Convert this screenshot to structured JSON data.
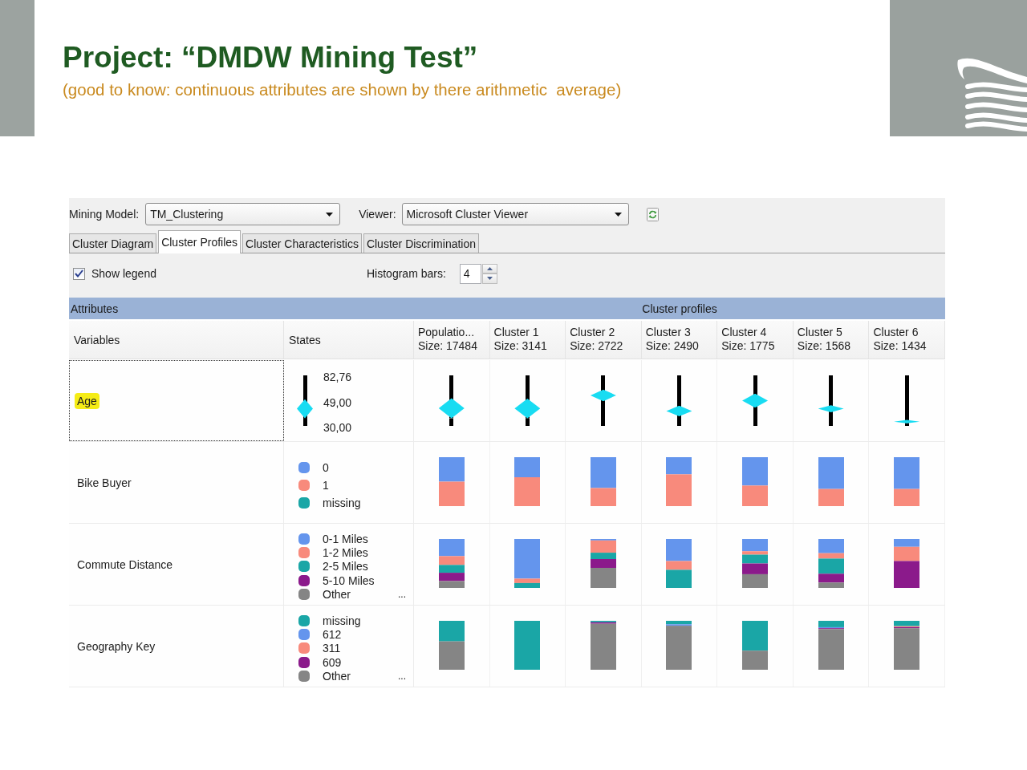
{
  "slide": {
    "title": "Project: “DMDW Mining Test”",
    "subtitle": "(good to know: continuous attributes are shown by there arithmetic  average)"
  },
  "toolbar": {
    "mining_model": {
      "label": "Mining Model:",
      "value": "TM_Clustering"
    },
    "viewer": {
      "label": "Viewer:",
      "value": "Microsoft Cluster Viewer"
    }
  },
  "tabs": [
    {
      "label": "Cluster Diagram",
      "selected": false
    },
    {
      "label": "Cluster Profiles",
      "selected": true
    },
    {
      "label": "Cluster Characteristics",
      "selected": false
    },
    {
      "label": "Cluster Discrimination",
      "selected": false
    }
  ],
  "options": {
    "show_legend": {
      "label": "Show legend",
      "checked": true
    },
    "histogram_bars": {
      "label": "Histogram bars:",
      "value": "4"
    }
  },
  "section_bar": {
    "attributes": "Attributes",
    "profiles": "Cluster profiles"
  },
  "grid": {
    "variables_heading": "Variables",
    "states_heading": "States",
    "clusters": [
      {
        "name": "Populatio...",
        "size": "Size: 17484"
      },
      {
        "name": "Cluster 1",
        "size": "Size: 3141"
      },
      {
        "name": "Cluster 2",
        "size": "Size: 2722"
      },
      {
        "name": "Cluster 3",
        "size": "Size: 2490"
      },
      {
        "name": "Cluster 4",
        "size": "Size: 1775"
      },
      {
        "name": "Cluster 5",
        "size": "Size: 1568"
      },
      {
        "name": "Cluster 6",
        "size": "Size: 1434"
      }
    ],
    "rows": [
      {
        "kind": "continuous",
        "variable": "Age",
        "selected": true,
        "highlighted": true,
        "scale": {
          "max": "82,76",
          "mean": "49,00",
          "min": "30,00"
        },
        "legend": {
          "mean": {
            "level": 0.34
          },
          "below": {
            "level": 0.15
          }
        },
        "cells": [
          {
            "mean": {
              "level": 0.35
            },
            "below": {
              "level": 0.15
            }
          },
          {
            "mean": {
              "level": 0.345
            },
            "below": {
              "level": 0.15
            }
          },
          {
            "mean": {
              "level": 0.605
            },
            "below": {
              "level": 0.49
            }
          },
          {
            "mean": {
              "level": 0.295
            },
            "below": {
              "level": 0.19
            }
          },
          {
            "mean": {
              "level": 0.5
            },
            "below": {
              "level": 0.36
            }
          },
          {
            "mean": {
              "level": 0.34
            },
            "below": {
              "level": 0.27
            }
          },
          {
            "mean": {
              "level": 0.085
            },
            "below": {
              "level": 0.05
            }
          }
        ]
      },
      {
        "kind": "discrete",
        "variable": "Bike Buyer",
        "selected": false,
        "highlighted": false,
        "states": [
          {
            "label": "0",
            "color": "#6495ed"
          },
          {
            "label": "1",
            "color": "#f88a7c"
          },
          {
            "label": "missing",
            "color": "#1aa6a6"
          }
        ]
      },
      {
        "kind": "discrete",
        "variable": "Commute Distance",
        "selected": false,
        "highlighted": false,
        "states": [
          {
            "label": "0-1 Miles",
            "color": "#6495ed"
          },
          {
            "label": "1-2 Miles",
            "color": "#f88a7c"
          },
          {
            "label": "2-5 Miles",
            "color": "#1aa6a6"
          },
          {
            "label": "5-10 Miles",
            "color": "#8b1a8b"
          },
          {
            "label": "Other",
            "color": "#858585"
          }
        ],
        "more": "..."
      },
      {
        "kind": "discrete",
        "variable": "Geography Key",
        "selected": false,
        "highlighted": false,
        "states": [
          {
            "label": "missing",
            "color": "#1aa6a6"
          },
          {
            "label": "612",
            "color": "#6495ed"
          },
          {
            "label": "311",
            "color": "#f88a7c"
          },
          {
            "label": "609",
            "color": "#8b1a8b"
          },
          {
            "label": "Other",
            "color": "#858585"
          }
        ],
        "more": "..."
      }
    ]
  }
}
